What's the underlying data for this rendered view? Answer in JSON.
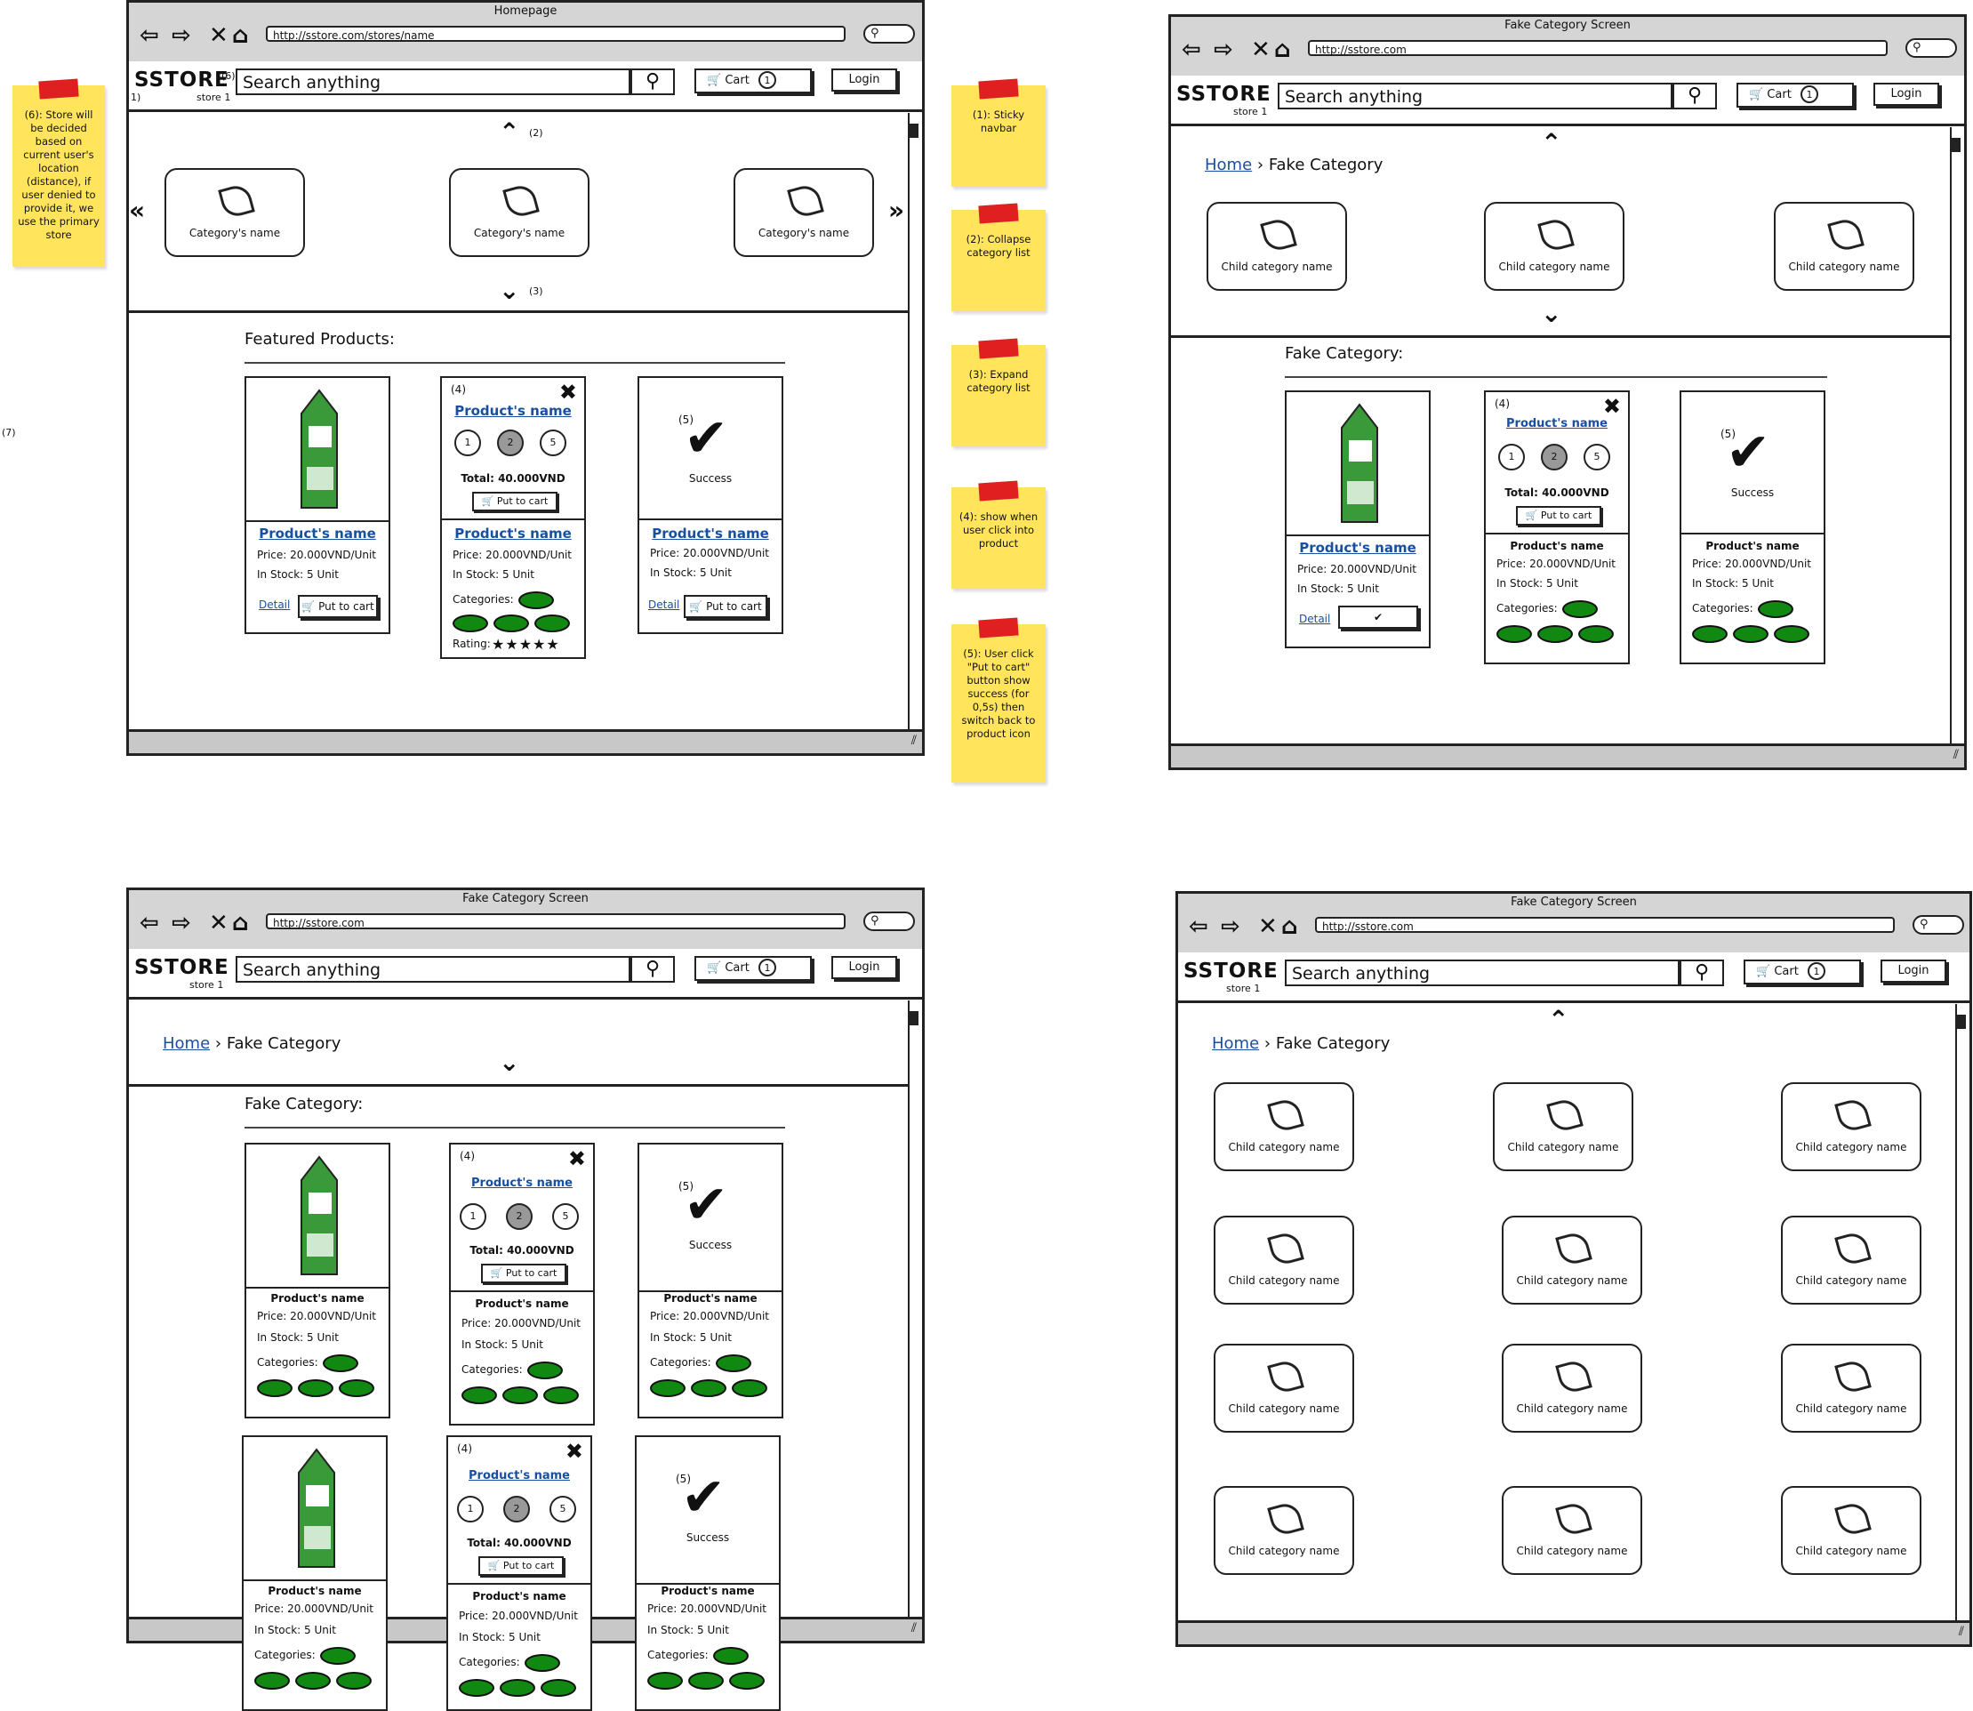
{
  "browser": {
    "homepage_title": "Homepage",
    "category_title": "Fake Category Screen",
    "homepage_url": "http://sstore.com/stores/name",
    "category_url": "http://sstore.com"
  },
  "navbar": {
    "logo": "SSTORE",
    "store": "store 1",
    "search_placeholder": "Search anything",
    "cart_label": "Cart",
    "cart_count": "1",
    "login_label": "Login",
    "marker_6": "(6)",
    "marker_1": "1)"
  },
  "homepage": {
    "category_name": "Category's name",
    "marker_2": "(2)",
    "marker_3": "(3)",
    "featured_title": "Featured Products:"
  },
  "category_page": {
    "breadcrumb_home": "Home",
    "breadcrumb_sep": "›",
    "breadcrumb_current": "Fake Category",
    "section_title": "Fake Category:",
    "child_category_name": "Child category name"
  },
  "product": {
    "name": "Product's name",
    "price": "Price: 20.000VND/Unit",
    "stock": "In Stock: 5 Unit",
    "detail": "Detail",
    "put_to_cart": "Put to cart",
    "categories": "Categories:",
    "rating": "Rating:",
    "total": "Total: 40.000VND",
    "qty_options": [
      "1",
      "2",
      "5"
    ],
    "success": "Success",
    "marker_4": "(4)",
    "marker_5": "(5)"
  },
  "notes": {
    "note6": "(6): Store will be decided based on current user's location (distance), if user denied to provide it, we use the primary store",
    "note1": "(1): Sticky navbar",
    "note2": "(2): Collapse category list",
    "note3": "(3): Expand category list",
    "note4": "(4): show when user click into product",
    "note5": "(5): User click \"Put to cart\" button show success (for 0,5s) then switch back to product icon",
    "marker_7": "(7)"
  }
}
